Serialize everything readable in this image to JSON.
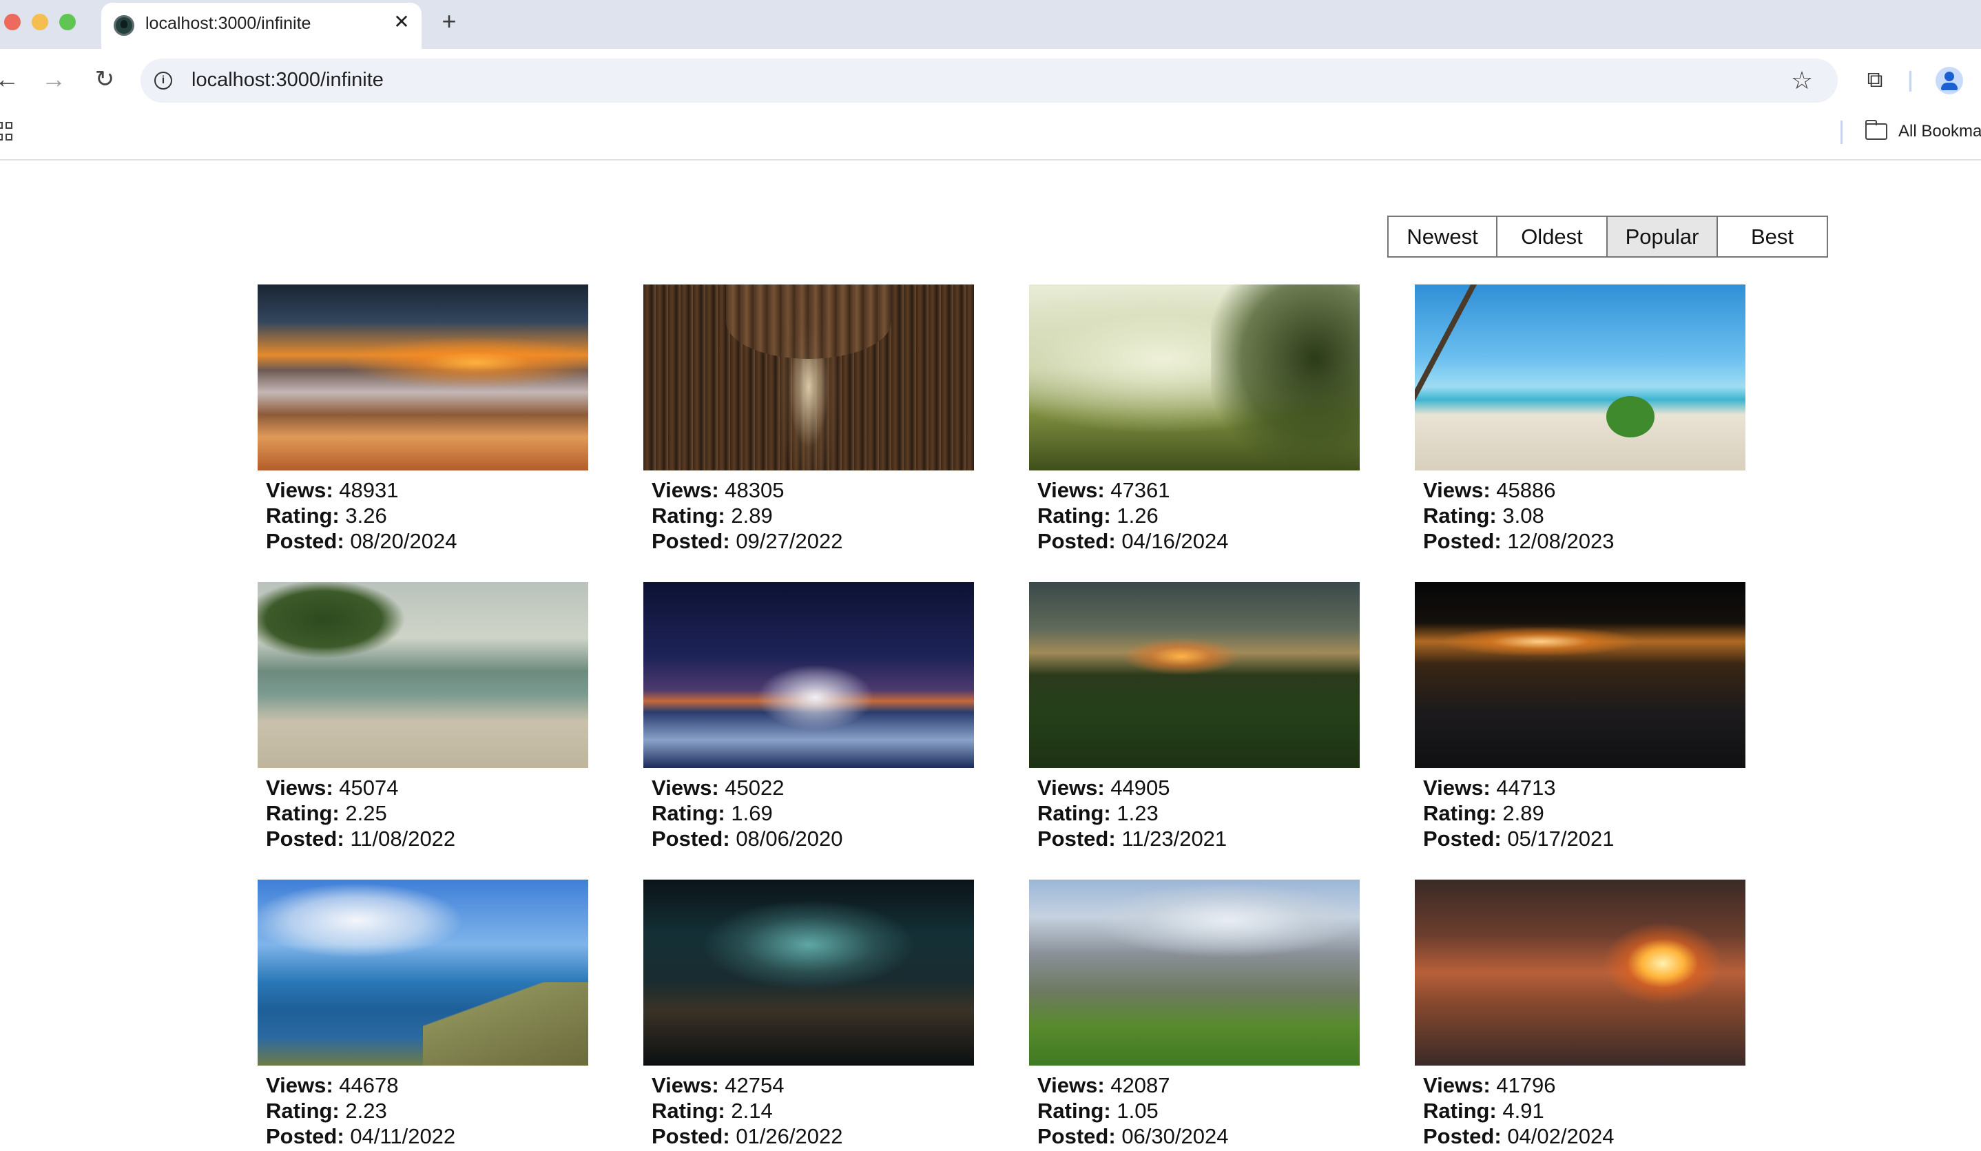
{
  "browser": {
    "tab_title": "localhost:3000/infinite",
    "tab_close": "✕",
    "new_tab": "+",
    "url": "localhost:3000/infinite",
    "bookmarks_label": "All Bookma"
  },
  "sort": {
    "options": [
      "Newest",
      "Oldest",
      "Popular",
      "Best"
    ],
    "active": "Popular"
  },
  "labels": {
    "views": "Views:",
    "rating": "Rating:",
    "posted": "Posted:"
  },
  "images": [
    {
      "views": "48931",
      "rating": "3.26",
      "posted": "08/20/2024"
    },
    {
      "views": "48305",
      "rating": "2.89",
      "posted": "09/27/2022"
    },
    {
      "views": "47361",
      "rating": "1.26",
      "posted": "04/16/2024"
    },
    {
      "views": "45886",
      "rating": "3.08",
      "posted": "12/08/2023"
    },
    {
      "views": "45074",
      "rating": "2.25",
      "posted": "11/08/2022"
    },
    {
      "views": "45022",
      "rating": "1.69",
      "posted": "08/06/2020"
    },
    {
      "views": "44905",
      "rating": "1.23",
      "posted": "11/23/2021"
    },
    {
      "views": "44713",
      "rating": "2.89",
      "posted": "05/17/2021"
    },
    {
      "views": "44678",
      "rating": "2.23",
      "posted": "04/11/2022"
    },
    {
      "views": "42754",
      "rating": "2.14",
      "posted": "01/26/2022"
    },
    {
      "views": "42087",
      "rating": "1.05",
      "posted": "06/30/2024"
    },
    {
      "views": "41796",
      "rating": "4.91",
      "posted": "04/02/2024"
    }
  ]
}
